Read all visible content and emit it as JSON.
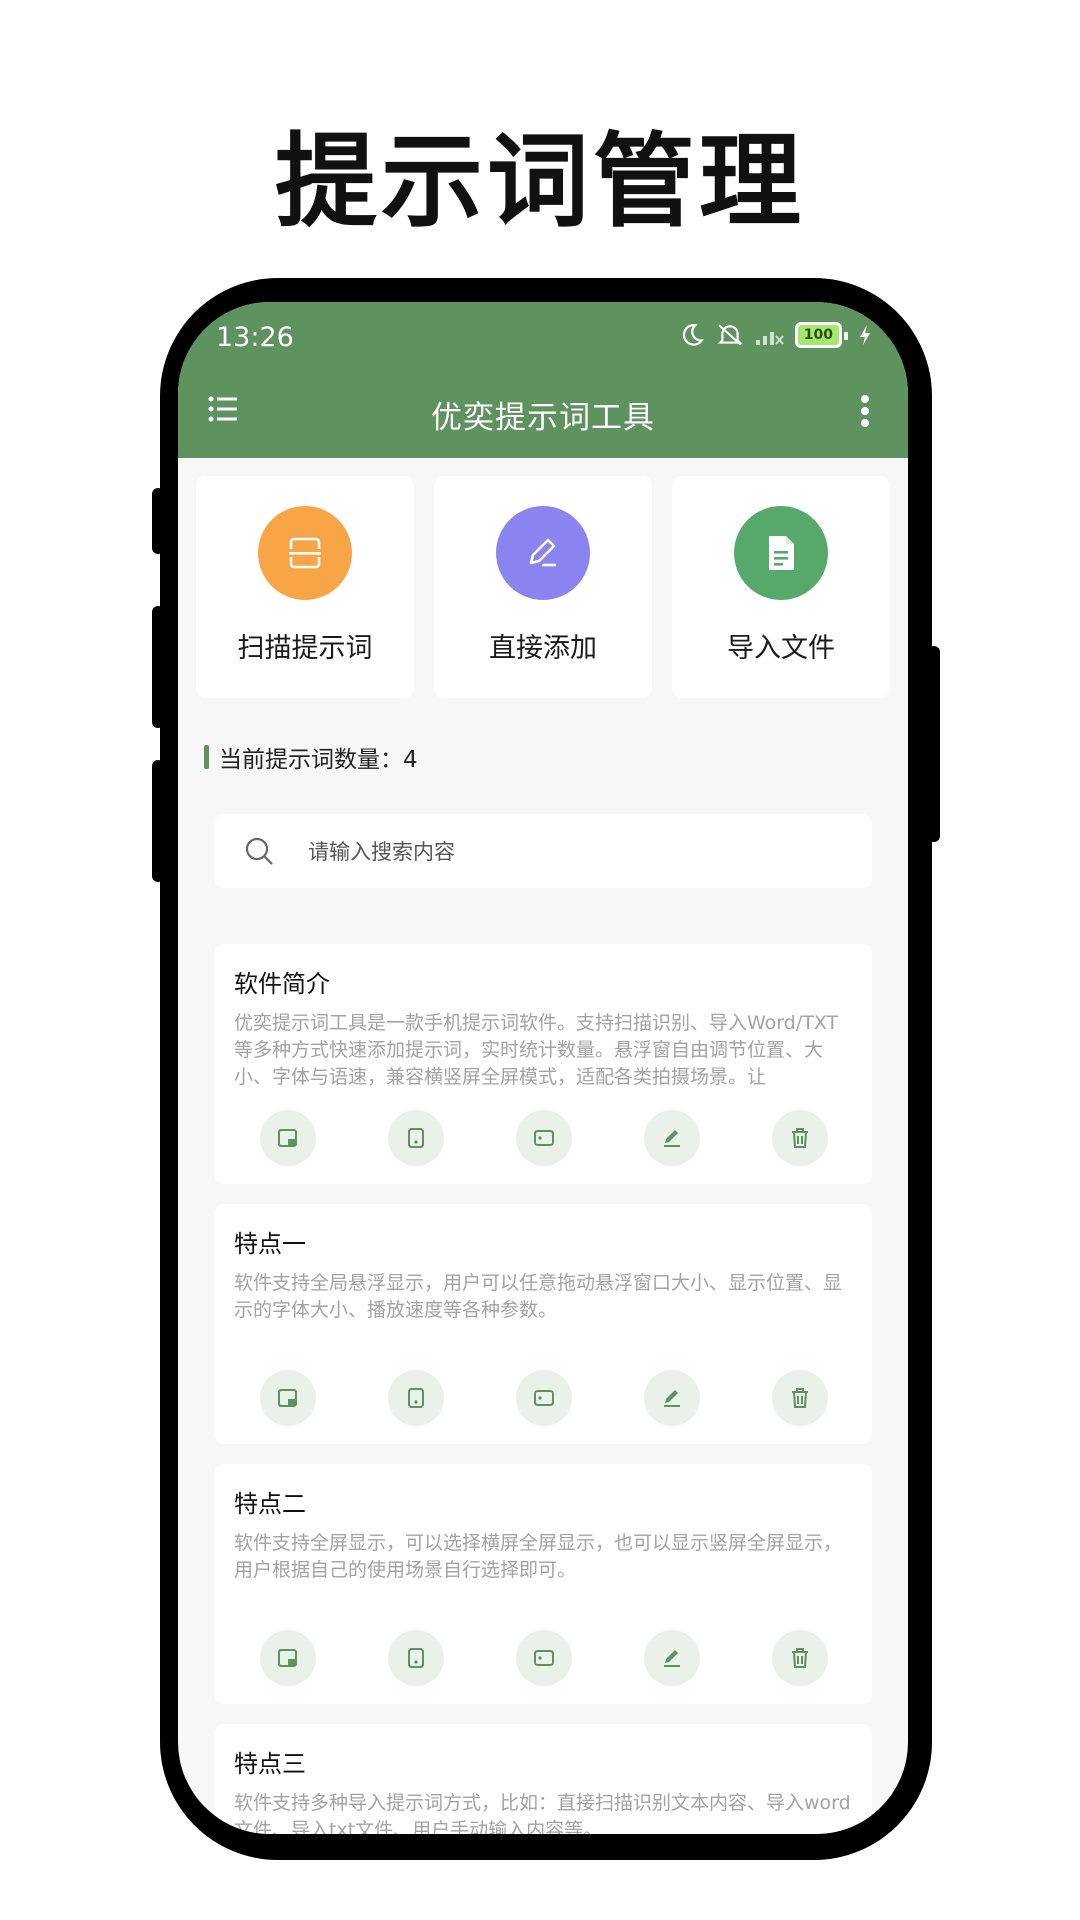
{
  "promo": {
    "title": "提示词管理"
  },
  "status_bar": {
    "time": "13:26",
    "battery": "100"
  },
  "toolbar": {
    "title": "优奕提示词工具"
  },
  "actions": [
    {
      "label": "扫描提示词",
      "icon": "scan-icon",
      "color": "#f8a548"
    },
    {
      "label": "直接添加",
      "icon": "pencil-icon",
      "color": "#8b83ef"
    },
    {
      "label": "导入文件",
      "icon": "document-icon",
      "color": "#56a86b"
    }
  ],
  "count": {
    "text": "当前提示词数量：4"
  },
  "search": {
    "placeholder": "请输入搜索内容"
  },
  "prompts": [
    {
      "title": "软件简介",
      "body": "优奕提示词工具是一款手机提示词软件。支持扫描识别、导入Word/TXT等多种方式快速添加提示词，实时统计数量。悬浮窗自由调节位置、大小、字体与语速，兼容横竖屏全屏模式，适配各类拍摄场景。让"
    },
    {
      "title": "特点一",
      "body": "软件支持全局悬浮显示，用户可以任意拖动悬浮窗口大小、显示位置、显示的字体大小、播放速度等各种参数。"
    },
    {
      "title": "特点二",
      "body": "软件支持全屏显示，可以选择横屏全屏显示，也可以显示竖屏全屏显示，用户根据自己的使用场景自行选择即可。"
    },
    {
      "title": "特点三",
      "body": "软件支持多种导入提示词方式，比如：直接扫描识别文本内容、导入word文件、导入txt文件、用户手动输入内容等。"
    }
  ],
  "card_action_icons": [
    "float-window-icon",
    "portrait-fullscreen-icon",
    "landscape-fullscreen-icon",
    "edit-icon",
    "delete-icon"
  ],
  "colors": {
    "primary": "#5e925e",
    "background": "#f7f7f7",
    "action_button_bg": "#e9f1e9"
  }
}
